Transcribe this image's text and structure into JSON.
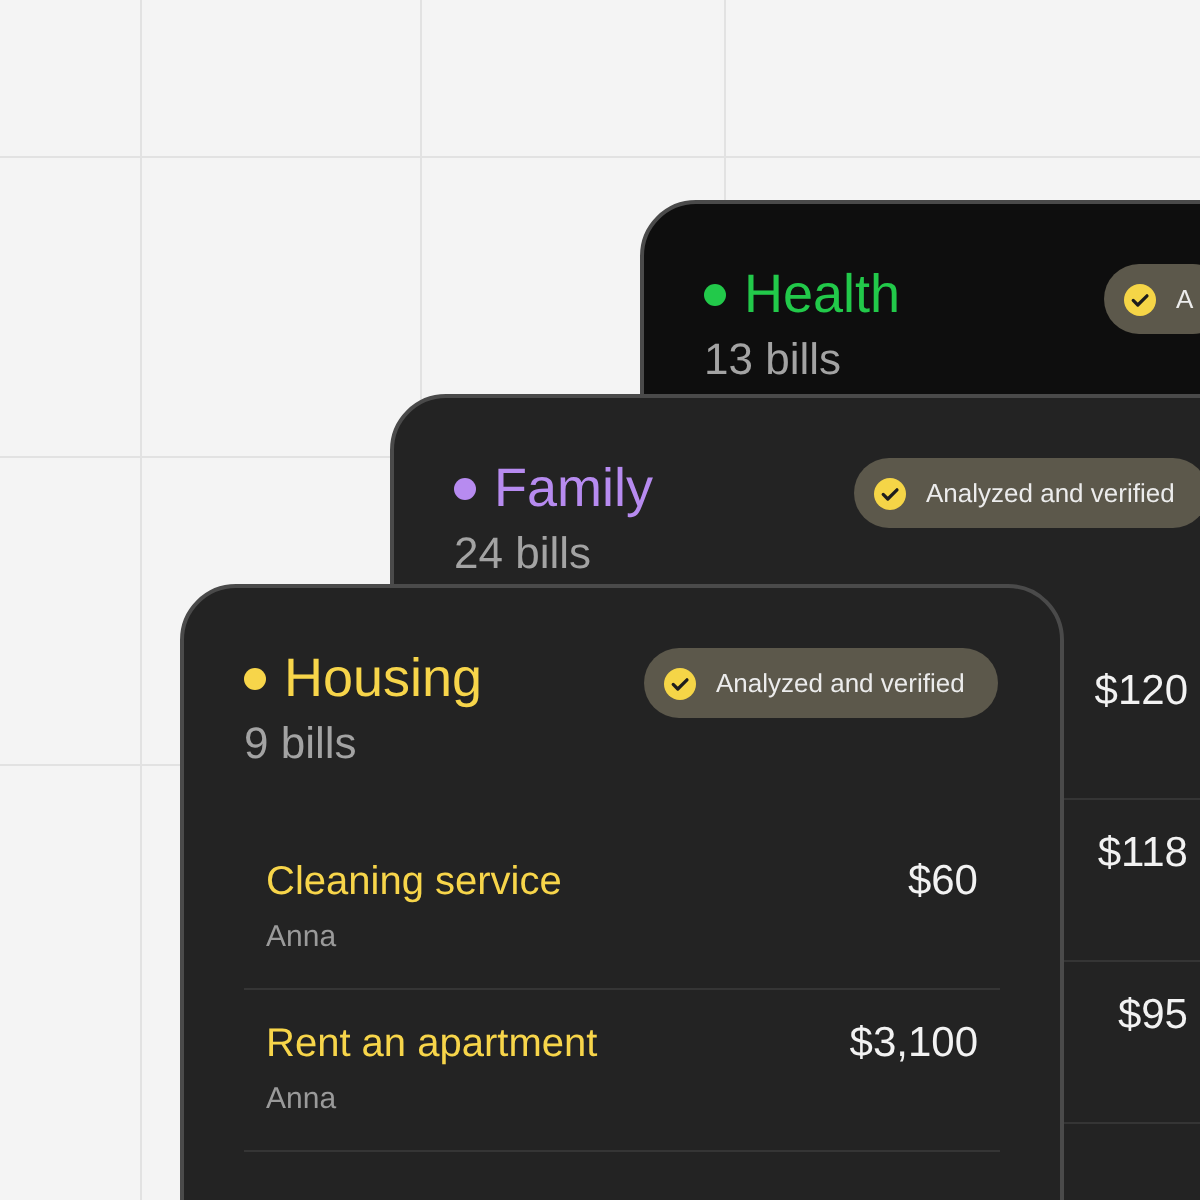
{
  "cards": [
    {
      "title": "Health",
      "color": "#22c94a",
      "count": "13 bills",
      "badge": "A"
    },
    {
      "title": "Family",
      "color": "#b78bf0",
      "count": "24 bills",
      "badge": "Analyzed and verified",
      "rows": [
        {
          "amount": "$120"
        },
        {
          "amount": "$118"
        },
        {
          "amount": "$95"
        }
      ]
    },
    {
      "title": "Housing",
      "color": "#f7d54a",
      "count": "9 bills",
      "badge": "Analyzed and verified",
      "rows": [
        {
          "name": "Cleaning service",
          "person": "Anna",
          "amount": "$60"
        },
        {
          "name": "Rent an apartment",
          "person": "Anna",
          "amount": "$3,100"
        }
      ]
    }
  ]
}
